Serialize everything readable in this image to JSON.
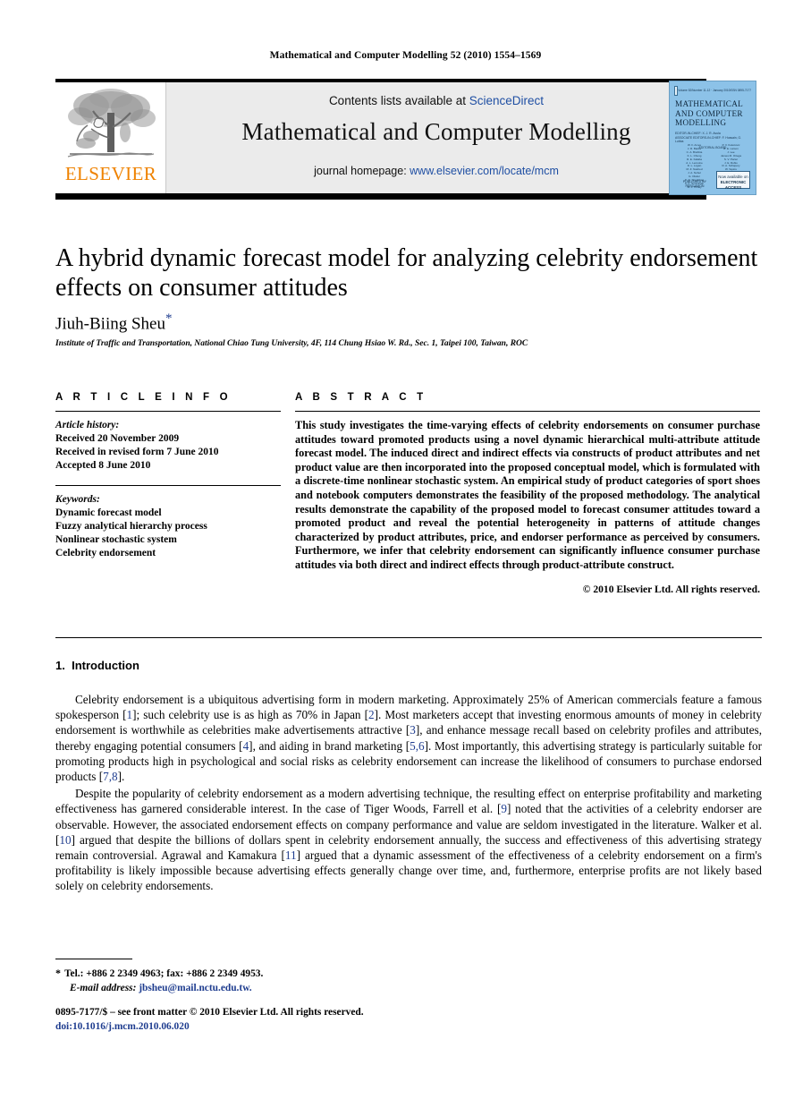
{
  "running_head": "Mathematical and Computer Modelling 52 (2010) 1554–1569",
  "journal_header": {
    "contents_prefix": "Contents lists available at ",
    "contents_link": "ScienceDirect",
    "journal_title": "Mathematical and Computer Modelling",
    "homepage_prefix": "journal homepage: ",
    "homepage_url": "www.elsevier.com/locate/mcm",
    "publisher_wordmark": "ELSEVIER",
    "link_color": "#1f4fa3",
    "elsevier_orange": "#ef8200",
    "band_background": "#ebebeb"
  },
  "cover": {
    "top_left_label": "ELSEVIER",
    "top_center_label": "Volume 52/Number 11-12 · January 2010",
    "top_right_label": "ISSN 0895-7177",
    "title_lines": [
      "MATHEMATICAL",
      "AND COMPUTER",
      "MODELLING"
    ],
    "editor_lines": [
      "EDITOR-IN-CHIEF: X. J. R. Avula",
      "ASSOCIATE EDITORS-IN-CHIEF: F. Hussain, G. Luhba"
    ],
    "board_heading": "EDITORIAL BOARD",
    "board_left": [
      "W. F. Ames",
      "J. R. Banks",
      "C. A. Brebbia",
      "K. L. Chung",
      "R. E. Kalaba",
      "A. L. Lemoine",
      "D. L. Logan",
      "M. Z. Nashed",
      "J. A. Nohel",
      "G. Olsder",
      "D. N. Shanbhag",
      "S. K. Srinivasan",
      "W. F. Tinney"
    ],
    "board_right": [
      "P. V. Kokotovic",
      "R. E. Larson",
      "J. Lee",
      "James M. Ortega",
      "S. V. Parter",
      "J. E. Rubio",
      "R. A. Schapery",
      "W. Squire",
      "L. A. Zadeh",
      "M. Z. Zhao",
      "A. Vande Wouwer",
      "E. Y. Rodin",
      "R. M. Wald"
    ],
    "badge_lines": [
      "Now available on",
      "ELECTRONIC",
      "ACCESS"
    ],
    "publisher_lines": [
      "PUBLISHED BY",
      "PERGAMON"
    ],
    "background_color": "#8cc2e8"
  },
  "article": {
    "title": "A hybrid dynamic forecast model for analyzing celebrity endorsement effects on consumer attitudes",
    "author": "Jiuh-Biing Sheu",
    "corresponding_marker": "*",
    "affiliation": "Institute of Traffic and Transportation, National Chiao Tung University, 4F, 114 Chung Hsiao W. Rd., Sec. 1, Taipei 100, Taiwan, ROC"
  },
  "article_info": {
    "heading": "A R T I C L E   I N F O",
    "history_label": "Article history:",
    "history": [
      "Received 20 November 2009",
      "Received in revised form 7 June 2010",
      "Accepted 8 June 2010"
    ],
    "keywords_label": "Keywords:",
    "keywords": [
      "Dynamic forecast model",
      "Fuzzy analytical hierarchy process",
      "Nonlinear stochastic system",
      "Celebrity endorsement"
    ]
  },
  "abstract": {
    "heading": "A B S T R A C T",
    "text": "This study investigates the time-varying effects of celebrity endorsements on consumer purchase attitudes toward promoted products using a novel dynamic hierarchical multi-attribute attitude forecast model. The induced direct and indirect effects via constructs of product attributes and net product value are then incorporated into the proposed conceptual model, which is formulated with a discrete-time nonlinear stochastic system. An empirical study of product categories of sport shoes and notebook computers demonstrates the feasibility of the proposed methodology. The analytical results demonstrate the capability of the proposed model to forecast consumer attitudes toward a promoted product and reveal the potential heterogeneity in patterns of attitude changes characterized by product attributes, price, and endorser performance as perceived by consumers. Furthermore, we infer that celebrity endorsement can significantly influence consumer purchase attitudes via both direct and indirect effects through product-attribute construct.",
    "copyright": "© 2010 Elsevier Ltd. All rights reserved."
  },
  "introduction": {
    "section_number": "1.",
    "section_title": "Introduction",
    "paragraph1_parts": [
      {
        "t": "Celebrity endorsement is a ubiquitous advertising form in modern marketing. Approximately 25% of American commercials feature a famous spokesperson ["
      },
      {
        "c": "1"
      },
      {
        "t": "]; such celebrity use is as high as 70% in Japan ["
      },
      {
        "c": "2"
      },
      {
        "t": "]. Most marketers accept that investing enormous amounts of money in celebrity endorsement is worthwhile as celebrities make advertisements attractive ["
      },
      {
        "c": "3"
      },
      {
        "t": "], and enhance message recall based on celebrity profiles and attributes, thereby engaging potential consumers ["
      },
      {
        "c": "4"
      },
      {
        "t": "], and aiding in brand marketing ["
      },
      {
        "c": "5,6"
      },
      {
        "t": "]. Most importantly, this advertising strategy is particularly suitable for promoting products high in psychological and social risks as celebrity endorsement can increase the likelihood of consumers to purchase endorsed products ["
      },
      {
        "c": "7,8"
      },
      {
        "t": "]."
      }
    ],
    "paragraph2_parts": [
      {
        "t": "Despite the popularity of celebrity endorsement as a modern advertising technique, the resulting effect on enterprise profitability and marketing effectiveness has garnered considerable interest. In the case of Tiger Woods, Farrell et al. ["
      },
      {
        "c": "9"
      },
      {
        "t": "] noted that the activities of a celebrity endorser are observable. However, the associated endorsement effects on company performance and value are seldom investigated in the literature. Walker et al. ["
      },
      {
        "c": "10"
      },
      {
        "t": "] argued that despite the billions of dollars spent in celebrity endorsement annually, the success and effectiveness of this advertising strategy remain controversial. Agrawal and Kamakura ["
      },
      {
        "c": "11"
      },
      {
        "t": "] argued that a dynamic assessment of the effectiveness of a celebrity endorsement on a firm's profitability is likely impossible because advertising effects generally change over time, and, furthermore, enterprise profits are not likely based solely on celebrity endorsements."
      }
    ]
  },
  "footnotes": {
    "marker": "*",
    "contact": "Tel.: +886 2 2349 4963; fax: +886 2 2349 4953.",
    "email_label": "E-mail address:",
    "email": "jbsheu@mail.nctu.edu.tw."
  },
  "footer": {
    "issn_line": "0895-7177/$ – see front matter © 2010 Elsevier Ltd. All rights reserved.",
    "doi": "doi:10.1016/j.mcm.2010.06.020"
  }
}
